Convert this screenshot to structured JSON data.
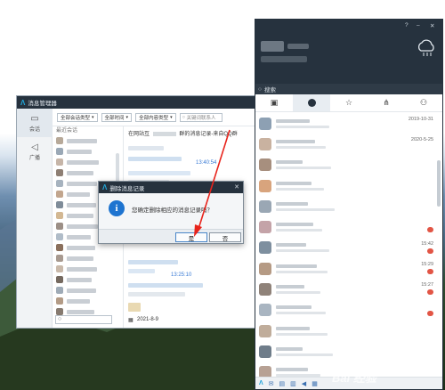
{
  "message_manager": {
    "title": "消息管理器",
    "side_tabs": [
      {
        "label": "会话",
        "icon": "chat-bubble-icon"
      },
      {
        "label": "广播",
        "icon": "megaphone-icon"
      }
    ],
    "filters": [
      "全部会话类型",
      "全部时间",
      "全部内容类型"
    ],
    "search_placeholder": "关键词联系人",
    "list_heading": "最近会话",
    "list_search_glyph": "○",
    "content_header_left": "在网站互",
    "content_header_right": "群的消息记录-来自QQ群",
    "time_1": "13:40:54",
    "time_2": "13:25:10",
    "date_label": "2021-8-9"
  },
  "dialog": {
    "title": "删除消息记录",
    "close_glyph": "✕",
    "info_glyph": "i",
    "message": "您确定删除相应的消息记录吗？",
    "yes_label": "是",
    "no_label": "否"
  },
  "qq_panel": {
    "top_controls": [
      "?",
      "–",
      "✕"
    ],
    "search_label": "搜索",
    "tabs": [
      {
        "name": "contacts-card",
        "icon": "contact-card-icon"
      },
      {
        "name": "recent",
        "icon": "clock-icon"
      },
      {
        "name": "favorites",
        "icon": "star-icon"
      },
      {
        "name": "groups",
        "icon": "org-chart-icon"
      },
      {
        "name": "users",
        "icon": "user-icon"
      }
    ],
    "rows": [
      {
        "date": "2019-10-31",
        "badge": false
      },
      {
        "date": "2020-5-25",
        "badge": false
      },
      {
        "date": "",
        "badge": false
      },
      {
        "date": "",
        "badge": false
      },
      {
        "date": "",
        "badge": false
      },
      {
        "date": "",
        "badge": true
      },
      {
        "date": "15:42",
        "badge": true
      },
      {
        "date": "15:29",
        "badge": true
      },
      {
        "date": "15:27",
        "badge": true
      },
      {
        "date": "",
        "badge": true
      },
      {
        "date": "",
        "badge": false
      },
      {
        "date": "",
        "badge": false
      },
      {
        "date": "",
        "badge": false
      }
    ]
  },
  "watermark": "Bai 经验"
}
